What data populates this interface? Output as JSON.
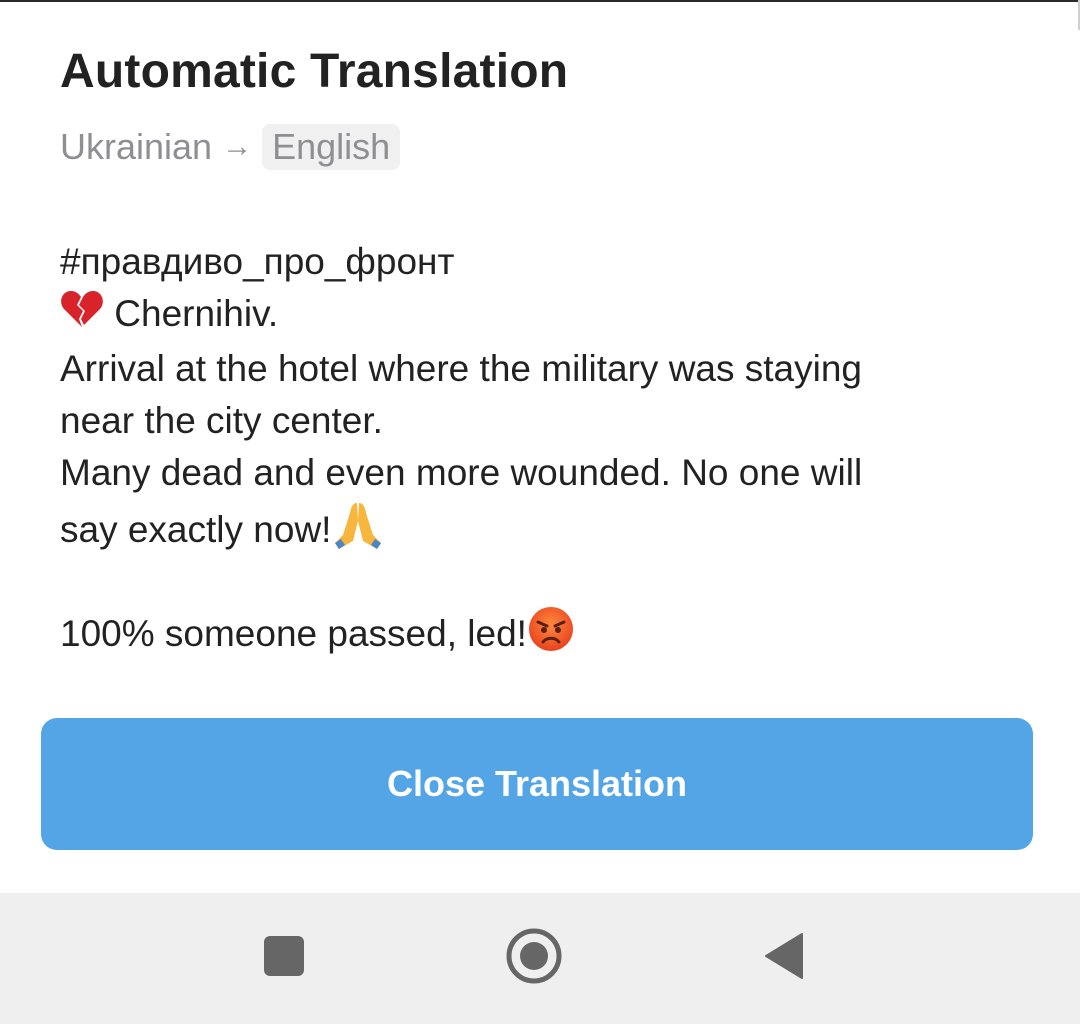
{
  "header": {
    "title": "Automatic Translation",
    "source_language": "Ukrainian",
    "arrow": "→",
    "target_language": "English"
  },
  "message": {
    "hashtag": "#правдиво_про_фронт",
    "line_city": "Chernihiv.",
    "line_1": "Arrival at the hotel where the military was staying",
    "line_2": "near the city center.",
    "line_3": "Many dead and even more wounded. No one will",
    "line_4": "say exactly now!",
    "line_5": "100% someone passed, led!",
    "emojis": [
      "broken-heart",
      "folded-hands",
      "angry-face"
    ]
  },
  "actions": {
    "close_label": "Close Translation"
  },
  "navbar": {
    "buttons": [
      "recents",
      "home",
      "back"
    ]
  },
  "colors": {
    "accent": "#54a5e6",
    "title_text": "#222222",
    "muted_text": "#8e8e93",
    "navbar_bg": "#efefef"
  }
}
